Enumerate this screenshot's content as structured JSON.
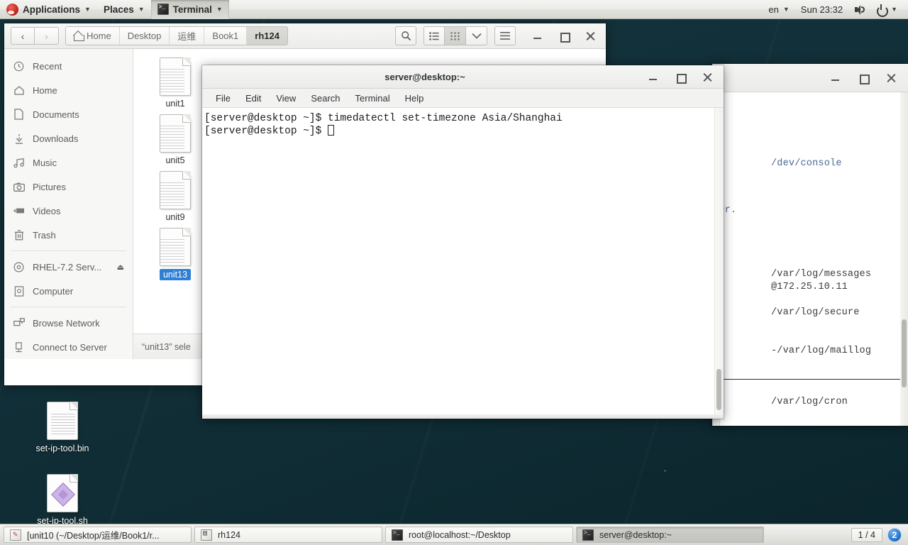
{
  "panel": {
    "applications": "Applications",
    "places": "Places",
    "active_app": "Terminal",
    "language": "en",
    "clock": "Sun 23:32"
  },
  "file_manager": {
    "breadcrumbs": [
      {
        "label": "Home",
        "icon": "home-icon",
        "current": false
      },
      {
        "label": "Desktop",
        "current": false
      },
      {
        "label": "运维",
        "current": false
      },
      {
        "label": "Book1",
        "current": false
      },
      {
        "label": "rh124",
        "current": true
      }
    ],
    "nav": {
      "back": "‹",
      "forward": "›"
    },
    "toolbar": {
      "search": "search-icon",
      "list_view": "list-view-icon",
      "grid_view": "grid-view-icon",
      "view_options": "chevron-down-icon",
      "menu": "hamburger-menu-icon"
    },
    "sidebar": [
      {
        "label": "Recent",
        "icon": "clock-icon"
      },
      {
        "label": "Home",
        "icon": "home-icon"
      },
      {
        "label": "Documents",
        "icon": "document-icon"
      },
      {
        "label": "Downloads",
        "icon": "download-icon"
      },
      {
        "label": "Music",
        "icon": "music-icon"
      },
      {
        "label": "Pictures",
        "icon": "camera-icon"
      },
      {
        "label": "Videos",
        "icon": "video-icon"
      },
      {
        "label": "Trash",
        "icon": "trash-icon"
      },
      {
        "label": "RHEL-7.2 Serv...",
        "icon": "disc-icon",
        "eject": "⏏"
      },
      {
        "label": "Computer",
        "icon": "computer-icon"
      },
      {
        "label": "Browse Network",
        "icon": "network-icon"
      },
      {
        "label": "Connect to Server",
        "icon": "server-icon"
      }
    ],
    "files": [
      {
        "name": "unit1",
        "selected": false
      },
      {
        "name": "unit5",
        "selected": false
      },
      {
        "name": "unit9",
        "selected": false
      },
      {
        "name": "unit13",
        "selected": true
      }
    ],
    "status": "“unit13” sele"
  },
  "terminal": {
    "title": "server@desktop:~",
    "menu": [
      "File",
      "Edit",
      "View",
      "Search",
      "Terminal",
      "Help"
    ],
    "lines": [
      "[server@desktop ~]$ timedatectl set-timezone Asia/Shanghai",
      "[server@desktop ~]$ "
    ]
  },
  "document_window": {
    "lines": [
      {
        "text": "/dev/console",
        "link": true
      },
      {
        "text": "her.",
        "link": true
      },
      {
        "text": "/var/log/messages",
        "link": false
      },
      {
        "text": "@172.25.10.11",
        "link": false
      },
      {
        "text": "/var/log/secure",
        "link": false
      },
      {
        "text": "-/var/log/maillog",
        "link": false
      },
      {
        "text": "/var/log/cron",
        "link": false
      }
    ]
  },
  "desktop_icons": [
    {
      "label": "set-ip-tool.bin",
      "icon": "text-file-icon"
    },
    {
      "label": "set-ip-tool.sh",
      "icon": "script-file-icon"
    }
  ],
  "taskbar": {
    "items": [
      {
        "label": "[unit10 (~/Desktop/运维/Book1/r...",
        "icon": "editor-icon",
        "active": false
      },
      {
        "label": "rh124",
        "icon": "file-manager-icon",
        "active": false
      },
      {
        "label": "root@localhost:~/Desktop",
        "icon": "terminal-icon",
        "active": false
      },
      {
        "label": "server@desktop:~",
        "icon": "terminal-icon",
        "active": true
      }
    ],
    "workspace": "1 / 4",
    "badge": "2"
  },
  "colors": {
    "selection": "#2f7fd4",
    "desktop": "#15333b",
    "panel": "#ebebe8",
    "link": "#4a6b93"
  }
}
